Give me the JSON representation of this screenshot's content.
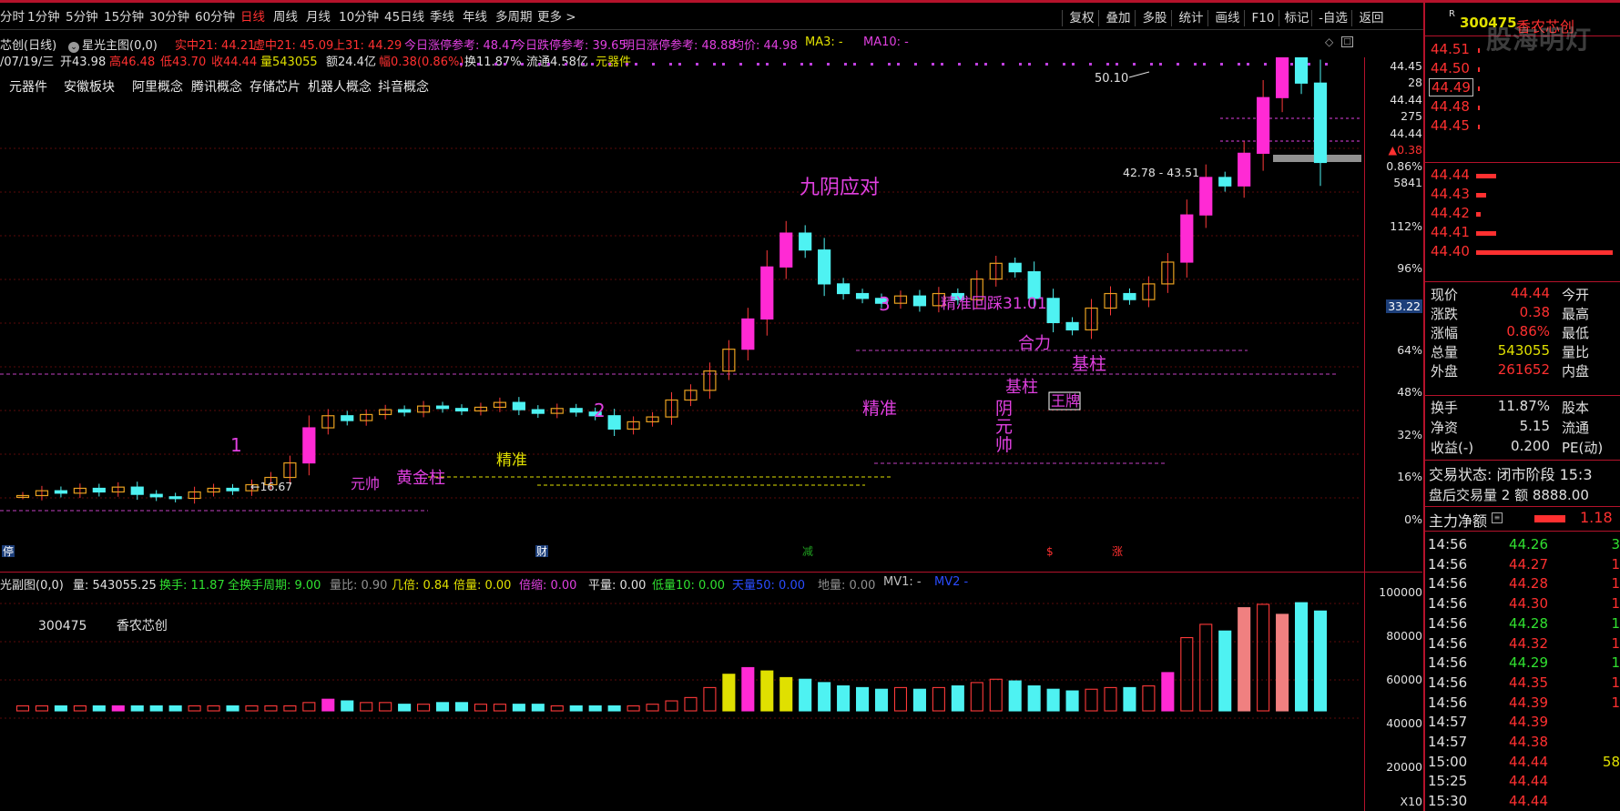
{
  "toolbar": {
    "periods": [
      "分时",
      "1分钟",
      "5分钟",
      "15分钟",
      "30分钟",
      "60分钟",
      "日线",
      "周线",
      "月线",
      "10分钟",
      "45日线",
      "季线",
      "年线",
      "多周期",
      "更多 >"
    ],
    "active": "日线",
    "tools": [
      "复权",
      "叠加",
      "多股",
      "统计",
      "画线",
      "F10",
      "标记",
      "-自选",
      "返回"
    ]
  },
  "stock": {
    "code": "300475",
    "name": "香农芯创",
    "badge": "R",
    "watermark": "股海明灯"
  },
  "main_chart": {
    "title": "芯创(日线)",
    "indicator": "星光主图(0,0)",
    "params": [
      {
        "label": "实中21: 44.21",
        "color": "#ff3030"
      },
      {
        "label": "虚中21: 45.09",
        "color": "#ff3030"
      },
      {
        "label": "上31: 44.29",
        "color": "#ff3030"
      },
      {
        "label": "今日涨停参考: 48.47",
        "color": "#e040e0"
      },
      {
        "label": "今日跌停参考: 39.65",
        "color": "#e040e0"
      },
      {
        "label": "明日涨停参考: 48.88",
        "color": "#e040e0"
      },
      {
        "label": "均价: 44.98",
        "color": "#e040e0"
      },
      {
        "label": "MA3: -",
        "color": "#e0e000"
      },
      {
        "label": "MA10: -",
        "color": "#e040e0"
      }
    ],
    "day_info": [
      {
        "label": "/07/19/三",
        "color": "#e0e0e0"
      },
      {
        "label": "开43.98",
        "color": "#e0e0e0"
      },
      {
        "label": "高46.48",
        "color": "#ff3030"
      },
      {
        "label": "低43.70",
        "color": "#ff3030"
      },
      {
        "label": "收44.44",
        "color": "#ff3030"
      },
      {
        "label": "量543055",
        "color": "#e0e000"
      },
      {
        "label": "额24.4亿",
        "color": "#e0e0e0"
      },
      {
        "label": "幅0.38(0.86%)",
        "color": "#ff3030"
      },
      {
        "label": "换11.87%",
        "color": "#e0e0e0"
      },
      {
        "label": "流通4.58亿",
        "color": "#e0e0e0"
      },
      {
        "label": "元器件",
        "color": "#e0e000"
      }
    ],
    "concepts": [
      "元器件",
      "安徽板块",
      "阿里概念",
      "腾讯概念",
      "存储芯片",
      "机器人概念",
      "抖音概念"
    ],
    "price_axis": [
      "44.45",
      "28",
      "44.44",
      "275",
      "44.44",
      "▲0.38",
      "0.86%",
      "5841",
      "112%",
      "96%",
      "33.22",
      "64%",
      "48%",
      "32%",
      "16%",
      "0%"
    ],
    "peak_label": "50.10",
    "range_label": "42.78 - 43.51",
    "low_label": "16.67",
    "annotations": [
      {
        "text": "九阴应对",
        "color": "#e040e0"
      },
      {
        "text": "3",
        "color": "#e040e0"
      },
      {
        "text": "精准回踩31.01",
        "color": "#e040e0"
      },
      {
        "text": "合力",
        "color": "#e040e0"
      },
      {
        "text": "基柱",
        "color": "#e040e0"
      },
      {
        "text": "基柱",
        "color": "#e040e0"
      },
      {
        "text": "王牌",
        "color": "#e040e0"
      },
      {
        "text": "精准",
        "color": "#e040e0"
      },
      {
        "text": "阴",
        "color": "#e040e0"
      },
      {
        "text": "元",
        "color": "#e040e0"
      },
      {
        "text": "帅",
        "color": "#e040e0"
      },
      {
        "text": "2",
        "color": "#e040e0"
      },
      {
        "text": "精准",
        "color": "#e0e000"
      },
      {
        "text": "1",
        "color": "#e040e0"
      },
      {
        "text": "黄金柱",
        "color": "#e040e0"
      },
      {
        "text": "元帅",
        "color": "#e040e0"
      }
    ],
    "markers": [
      {
        "text": "停",
        "color": "#4040ff"
      },
      {
        "text": "财",
        "color": "#4040ff"
      },
      {
        "text": "减",
        "color": "#20a020"
      },
      {
        "text": "$",
        "color": "#ff3030"
      },
      {
        "text": "涨",
        "color": "#ff3030"
      }
    ]
  },
  "sub_chart": {
    "title": "光副图(0,0)",
    "params": [
      {
        "label": "量: 543055.25",
        "color": "#e0e0e0"
      },
      {
        "label": "换手: 11.87",
        "color": "#30e030"
      },
      {
        "label": "全换手周期: 9.00",
        "color": "#30e030"
      },
      {
        "label": "量比: 0.90",
        "color": "#909090"
      },
      {
        "label": "几倍: 0.84",
        "color": "#e0e000"
      },
      {
        "label": "倍量: 0.00",
        "color": "#e0e000"
      },
      {
        "label": "倍缩: 0.00",
        "color": "#e040e0"
      },
      {
        "label": "平量: 0.00",
        "color": "#e0e0e0"
      },
      {
        "label": "低量10: 0.00",
        "color": "#30e030"
      },
      {
        "label": "天量50: 0.00",
        "color": "#2a4cff"
      },
      {
        "label": "地量: 0.00",
        "color": "#909090"
      },
      {
        "label": "MV1: -",
        "color": "#c0c0c0"
      },
      {
        "label": "MV2 -",
        "color": "#2a4cff"
      }
    ],
    "code": "300475",
    "name": "香农芯创",
    "vol_axis": [
      "100000",
      "80000",
      "60000",
      "40000",
      "20000",
      "X10"
    ]
  },
  "chart_data": {
    "type": "candlestick",
    "period": "日线",
    "pattern": "candles",
    "closes": [
      16.9,
      17.3,
      17.1,
      17.5,
      17.2,
      17.6,
      17.0,
      16.8,
      16.67,
      17.2,
      17.5,
      17.3,
      17.8,
      18.4,
      19.6,
      22.5,
      23.5,
      23.1,
      23.6,
      24.0,
      23.8,
      24.3,
      24.1,
      23.9,
      24.2,
      24.6,
      24.0,
      23.7,
      24.1,
      23.8,
      23.5,
      22.4,
      23.0,
      23.4,
      24.8,
      25.6,
      27.2,
      29.0,
      31.5,
      35.8,
      38.6,
      37.2,
      34.4,
      33.6,
      33.2,
      32.8,
      33.4,
      32.6,
      33.6,
      33.1,
      34.8,
      36.1,
      35.4,
      33.2,
      31.2,
      30.6,
      32.4,
      33.6,
      33.1,
      34.4,
      36.2,
      40.1,
      43.2,
      42.5,
      45.2,
      49.8,
      53.4,
      51.0,
      44.44
    ],
    "volumes": [
      3,
      3,
      3,
      3,
      3,
      3,
      3,
      3,
      3,
      3,
      3,
      3,
      3,
      3,
      3,
      5,
      7,
      6,
      5,
      5,
      4,
      4,
      5,
      5,
      4,
      4,
      4,
      4,
      3,
      3,
      3,
      3,
      3,
      4,
      6,
      8,
      14,
      22,
      26,
      24,
      20,
      19,
      17,
      15,
      14,
      13,
      14,
      13,
      14,
      15,
      17,
      19,
      18,
      15,
      13,
      12,
      13,
      14,
      14,
      15,
      23,
      44,
      52,
      48,
      62,
      64,
      58,
      65,
      60
    ]
  },
  "right_panel": {
    "asks": [
      {
        "price": "44.51",
        "bar": 2
      },
      {
        "price": "44.50",
        "bar": 2
      },
      {
        "price": "44.49",
        "bar": 2
      },
      {
        "price": "44.48",
        "bar": 2
      },
      {
        "price": "44.45",
        "bar": 2
      }
    ],
    "bids": [
      {
        "price": "44.44",
        "bar": 22
      },
      {
        "price": "44.43",
        "bar": 11
      },
      {
        "price": "44.42",
        "bar": 5
      },
      {
        "price": "44.41",
        "bar": 22
      },
      {
        "price": "44.40",
        "bar": 150
      }
    ],
    "stats": [
      {
        "k1": "现价",
        "v1": "44.44",
        "c1": "#ff3030",
        "k2": "今开"
      },
      {
        "k1": "涨跌",
        "v1": "0.38",
        "c1": "#ff3030",
        "k2": "最高"
      },
      {
        "k1": "涨幅",
        "v1": "0.86%",
        "c1": "#ff3030",
        "k2": "最低"
      },
      {
        "k1": "总量",
        "v1": "543055",
        "c1": "#e0e000",
        "k2": "量比"
      },
      {
        "k1": "外盘",
        "v1": "261652",
        "c1": "#ff3030",
        "k2": "内盘"
      }
    ],
    "stats2": [
      {
        "k1": "换手",
        "v1": "11.87%",
        "k2": "股本"
      },
      {
        "k1": "净资",
        "v1": "5.15",
        "k2": "流通"
      },
      {
        "k1": "收益(-)",
        "v1": "0.200",
        "k2": "PE(动)"
      }
    ],
    "trade_state": "交易状态: 闭市阶段 15:3",
    "after_hours": "盘后交易量 2 额 8888.00",
    "net_flow_label": "主力净额",
    "net_flow_value": "1.18",
    "ticks": [
      {
        "time": "14:56",
        "price": "44.26",
        "pc": "#30e030",
        "vol": "3",
        "vc": "#30e030"
      },
      {
        "time": "14:56",
        "price": "44.27",
        "pc": "#ff3030",
        "vol": "1",
        "vc": "#ff3030"
      },
      {
        "time": "14:56",
        "price": "44.28",
        "pc": "#ff3030",
        "vol": "1",
        "vc": "#ff3030"
      },
      {
        "time": "14:56",
        "price": "44.30",
        "pc": "#ff3030",
        "vol": "1",
        "vc": "#ff3030"
      },
      {
        "time": "14:56",
        "price": "44.28",
        "pc": "#30e030",
        "vol": "1",
        "vc": "#30e030"
      },
      {
        "time": "14:56",
        "price": "44.32",
        "pc": "#ff3030",
        "vol": "1",
        "vc": "#ff3030"
      },
      {
        "time": "14:56",
        "price": "44.29",
        "pc": "#30e030",
        "vol": "1",
        "vc": "#30e030"
      },
      {
        "time": "14:56",
        "price": "44.35",
        "pc": "#ff3030",
        "vol": "1",
        "vc": "#ff3030"
      },
      {
        "time": "14:56",
        "price": "44.39",
        "pc": "#ff3030",
        "vol": "1",
        "vc": "#ff3030"
      },
      {
        "time": "14:57",
        "price": "44.39",
        "pc": "#ff3030",
        "vol": "",
        "vc": "#ff3030"
      },
      {
        "time": "14:57",
        "price": "44.38",
        "pc": "#ff3030",
        "vol": "",
        "vc": "#ff3030"
      },
      {
        "time": "15:00",
        "price": "44.44",
        "pc": "#ff3030",
        "vol": "58",
        "vc": "#e0e000"
      },
      {
        "time": "15:25",
        "price": "44.44",
        "pc": "#ff3030",
        "vol": "",
        "vc": "#ff3030"
      },
      {
        "time": "15:30",
        "price": "44.44",
        "pc": "#ff3030",
        "vol": "",
        "vc": "#ff3030"
      }
    ]
  }
}
